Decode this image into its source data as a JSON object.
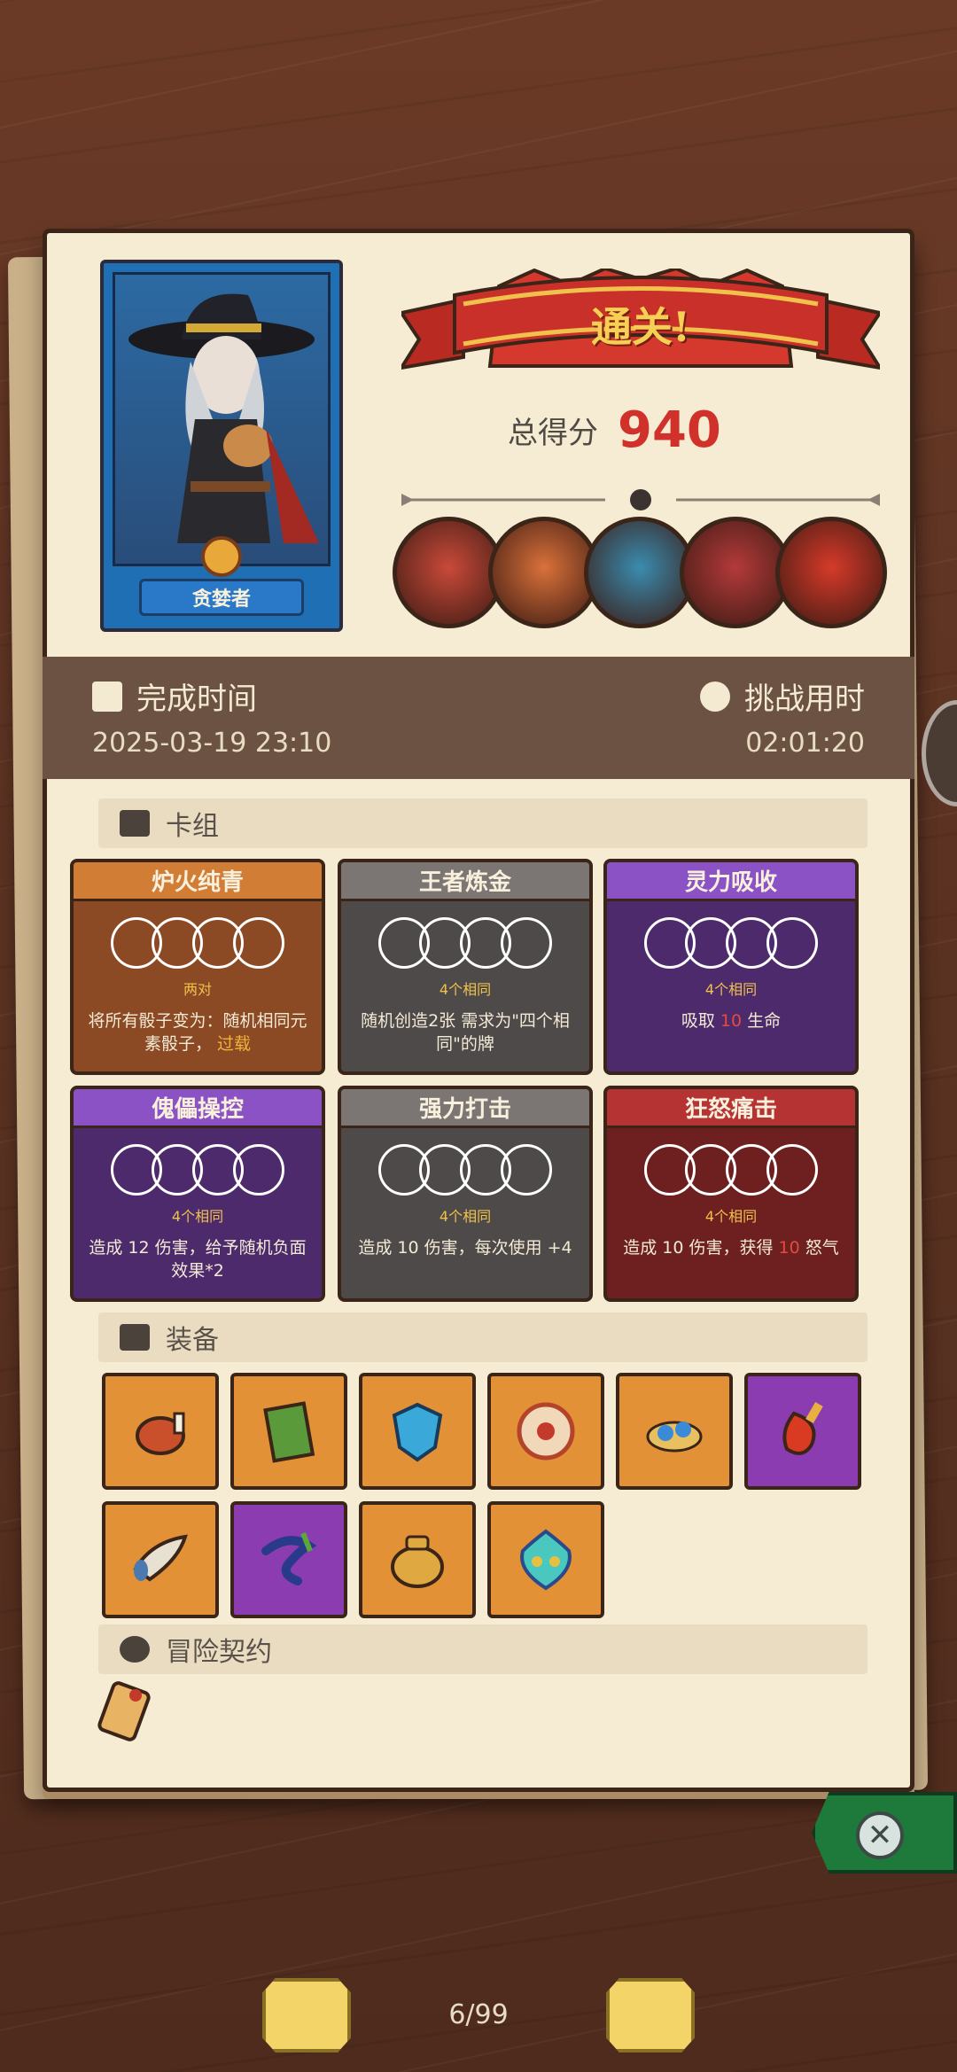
{
  "result": {
    "banner": "通关!",
    "score_label": "总得分",
    "score_value": "940"
  },
  "character": {
    "name": "贪婪者"
  },
  "bosses": [
    {
      "name": "boss-cyclops-icon",
      "color": "#c94a3a"
    },
    {
      "name": "boss-ogre-icon",
      "color": "#d9713a"
    },
    {
      "name": "boss-knight-icon",
      "color": "#3a8cb0"
    },
    {
      "name": "boss-clown-icon",
      "color": "#b33a3a"
    },
    {
      "name": "boss-flame-icon",
      "color": "#d63a2a"
    }
  ],
  "info": {
    "completion_label": "完成时间",
    "completion_value": "2025-03-19 23:10",
    "duration_label": "挑战用时",
    "duration_value": "02:01:20"
  },
  "deck": {
    "title": "卡组",
    "cards": [
      {
        "title": "炉火纯青",
        "sub": "两对",
        "circles": 4,
        "desc_main": "将所有骰子变为：随机相同元素骰子，",
        "desc_hl": "过载",
        "theme": "orange"
      },
      {
        "title": "王者炼金",
        "sub": "4个相同",
        "circles": 4,
        "desc_main": "随机创造2张 需求为\"四个相同\"的牌",
        "desc_hl": "",
        "theme": "gray"
      },
      {
        "title": "灵力吸收",
        "sub": "4个相同",
        "circles": 4,
        "desc_main": "吸取",
        "desc_hl": "10",
        "desc_tail": "生命",
        "theme": "purple"
      },
      {
        "title": "傀儡操控",
        "sub": "4个相同",
        "circles": 4,
        "desc_main": "造成 12 伤害，给予随机负面效果*2",
        "desc_hl": "",
        "theme": "purple"
      },
      {
        "title": "强力打击",
        "sub": "4个相同",
        "circles": 4,
        "desc_main": "造成 10 伤害，每次使用 +4",
        "desc_hl": "",
        "theme": "gray"
      },
      {
        "title": "狂怒痛击",
        "sub": "4个相同",
        "circles": 4,
        "desc_main": "造成 10 伤害，获得",
        "desc_hl": "10",
        "desc_tail": "怒气",
        "theme": "red"
      }
    ]
  },
  "equipment": {
    "title": "装备",
    "items": [
      {
        "name": "meat-icon",
        "bg": "orange"
      },
      {
        "name": "book-icon",
        "bg": "orange"
      },
      {
        "name": "shield-icon",
        "bg": "orange"
      },
      {
        "name": "eye-orb-icon",
        "bg": "orange"
      },
      {
        "name": "blue-gem-icon",
        "bg": "orange"
      },
      {
        "name": "red-gourd-icon",
        "bg": "purple"
      },
      {
        "name": "horn-icon",
        "bg": "orange"
      },
      {
        "name": "feather-icon",
        "bg": "purple"
      },
      {
        "name": "coin-bag-icon",
        "bg": "orange"
      },
      {
        "name": "flame-mask-icon",
        "bg": "orange"
      }
    ]
  },
  "contract": {
    "title": "冒险契约"
  },
  "pagination": {
    "text": "6/99"
  }
}
